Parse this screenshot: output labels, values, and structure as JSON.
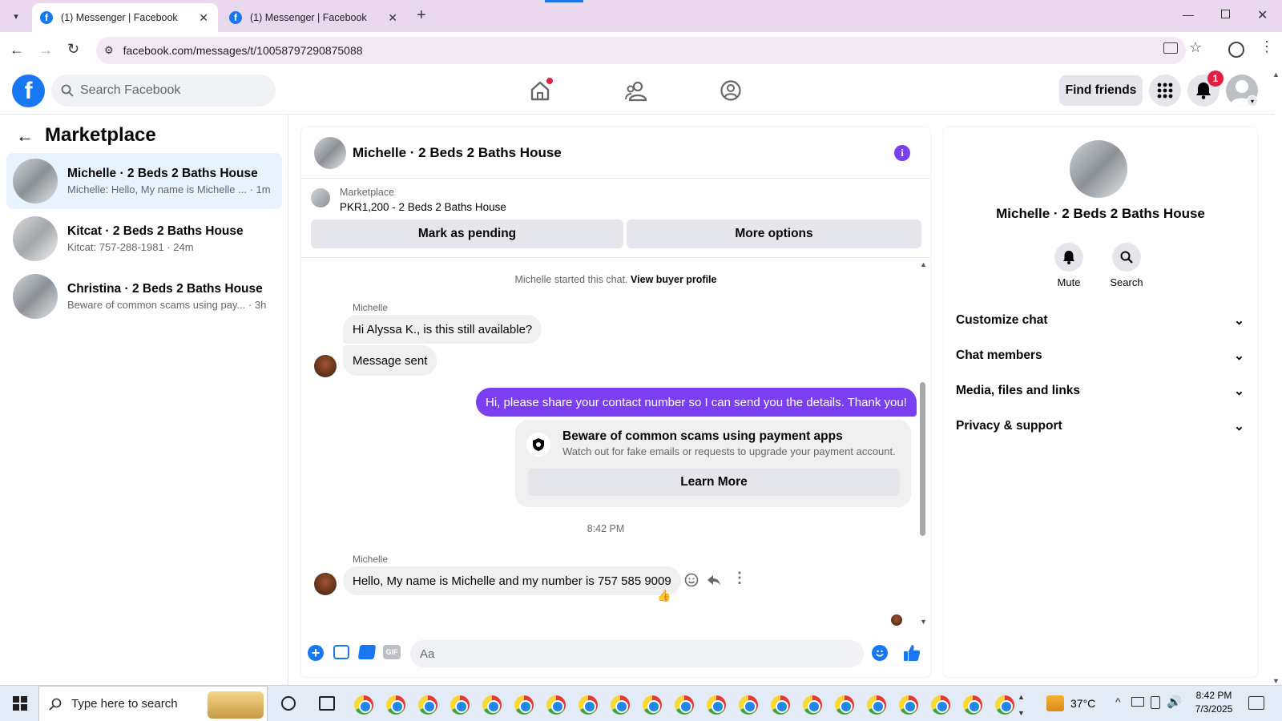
{
  "browser": {
    "tabs": [
      {
        "label": "(1) Messenger | Facebook"
      },
      {
        "label": "(1) Messenger | Facebook"
      }
    ],
    "url": "facebook.com/messages/t/10058797290875088"
  },
  "fb": {
    "search_placeholder": "Search Facebook",
    "find_friends": "Find friends",
    "notif_count": "1"
  },
  "left": {
    "title": "Marketplace",
    "conversations": [
      {
        "title": "Michelle · 2 Beds 2 Baths House",
        "preview": "Michelle: Hello, My name is Michelle ...",
        "time": "· 1m"
      },
      {
        "title": "Kitcat · 2 Beds 2 Baths House",
        "preview": "Kitcat: 757-288-1981",
        "time": "· 24m"
      },
      {
        "title": "Christina · 2 Beds 2 Baths House",
        "preview": "Beware of common scams using pay...",
        "time": "· 3h"
      }
    ]
  },
  "chat": {
    "title": "Michelle · 2 Beds 2 Baths House",
    "listing_source": "Marketplace",
    "listing_price": "PKR1,200 - 2 Beds 2 Baths House",
    "mark_pending": "Mark as pending",
    "more_options": "More options",
    "started_text": "Michelle started this chat.",
    "view_profile": "View buyer profile",
    "sender_name": "Michelle",
    "msg1": "Hi Alyssa K., is this still available?",
    "msg2": "Message sent",
    "my_msg": "Hi, please share your contact number so I can send you the details. Thank you!",
    "scam_title": "Beware of common scams using payment apps",
    "scam_body": "Watch out for fake emails or requests to upgrade your payment account.",
    "learn_more": "Learn More",
    "timestamp": "8:42 PM",
    "sender_name2": "Michelle",
    "msg3": "Hello, My name is Michelle and my number is 757 585 9009",
    "composer_placeholder": "Aa",
    "gif_label": "GIF"
  },
  "info": {
    "name": "Michelle · 2 Beds 2 Baths House",
    "mute": "Mute",
    "search": "Search",
    "sections": [
      "Customize chat",
      "Chat members",
      "Media, files and links",
      "Privacy & support"
    ]
  },
  "taskbar": {
    "search_placeholder": "Type here to search",
    "weather": "37°C",
    "time": "8:42 PM",
    "date": "7/3/2025"
  },
  "colors": {
    "fb_blue": "#1877f2",
    "messenger_purple": "#7a3ff0",
    "browser_tabbar": "#ead8ef"
  }
}
